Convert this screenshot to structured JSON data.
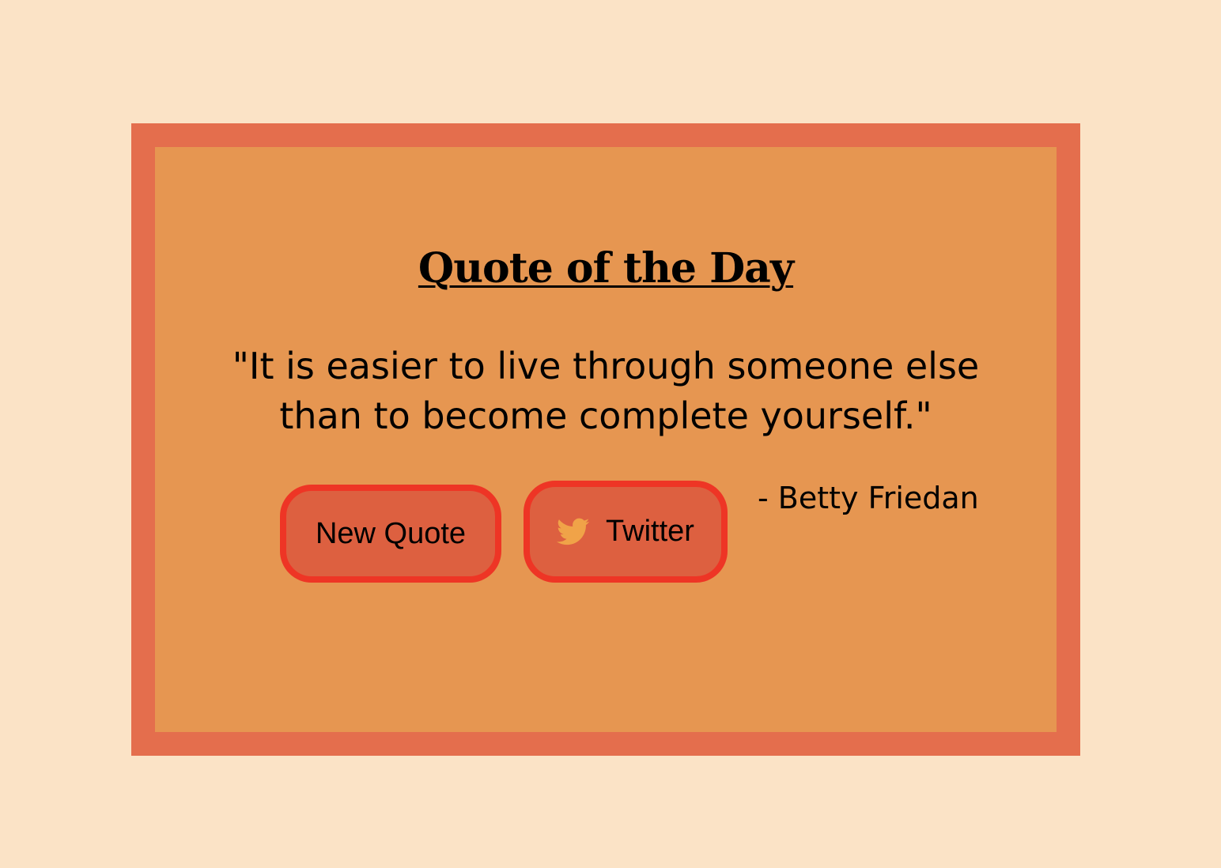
{
  "title": "Quote of the Day",
  "quote": "\"It is easier to live through someone else than to become complete yourself.\"",
  "author": "- Betty Friedan",
  "buttons": {
    "new_quote_label": "New Quote",
    "twitter_label": "Twitter",
    "twitter_icon": "twitter-bird-icon"
  },
  "colors": {
    "page_bg": "#fbe3c6",
    "frame_border": "#e46e4d",
    "card_bg": "#e69651",
    "button_bg": "#dd6040",
    "button_border": "#ee3525",
    "twitter_icon": "#f0a348"
  }
}
